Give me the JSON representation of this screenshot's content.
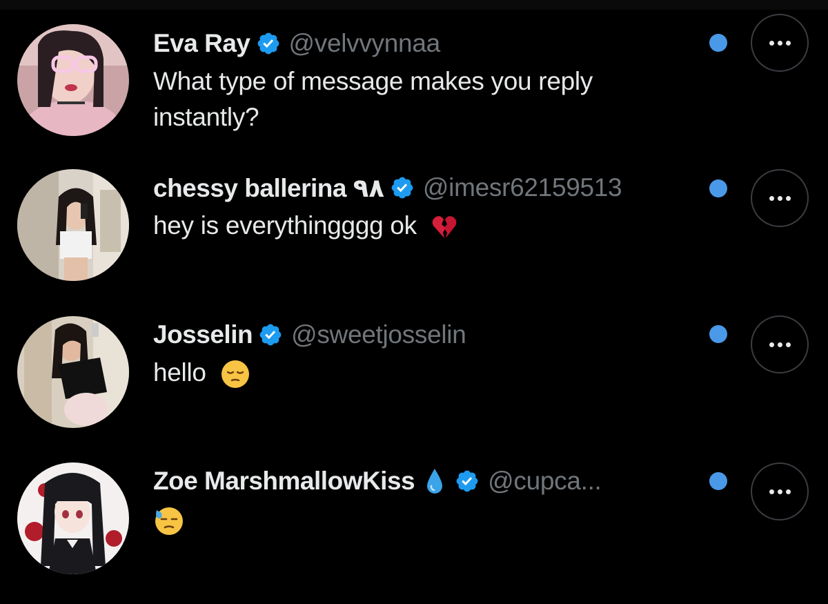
{
  "conversations": [
    {
      "name": "Eva Ray",
      "handle": "@velvvynnaa",
      "verified": true,
      "unread": true,
      "message_line1": "What type of message makes you reply",
      "message_line2": "instantly?"
    },
    {
      "name": "chessy ballerina ٩٨",
      "handle": "@imesr62159513",
      "verified": true,
      "unread": true,
      "message": "hey is everythingggg ok",
      "message_emoji": "broken-heart-icon"
    },
    {
      "name": "Josselin",
      "handle": "@sweetjosselin",
      "verified": true,
      "unread": true,
      "message": "hello",
      "message_emoji": "pensive-face-icon"
    },
    {
      "name": "Zoe MarshmallowKiss",
      "name_emoji": "droplet-icon",
      "handle": "@cupca...",
      "verified": true,
      "unread": true,
      "message_emoji": "downcast-face-with-sweat-icon"
    }
  ],
  "colors": {
    "background": "#000000",
    "text": "#e7e9ea",
    "handle": "#71767b",
    "unread_dot": "#4a99e9",
    "verified_badge": "#1d9bf0"
  }
}
